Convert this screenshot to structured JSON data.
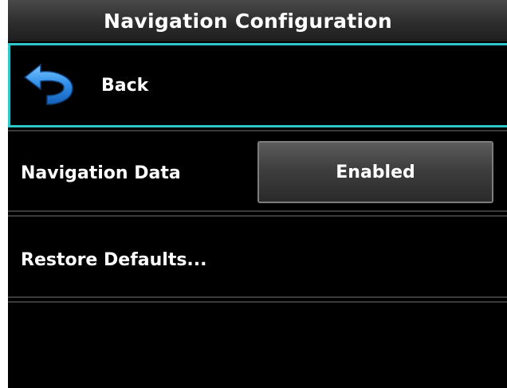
{
  "header": {
    "title": "Navigation Configuration"
  },
  "back_row": {
    "label": "Back",
    "icon": "back-arrow-icon"
  },
  "navigation_data_row": {
    "label": "Navigation Data",
    "value": "Enabled"
  },
  "restore_row": {
    "label": "Restore Defaults..."
  },
  "colors": {
    "background": "#000000",
    "selection_border": "#2ec7c9",
    "icon_blue": "#2f8ee8",
    "text": "#ffffff"
  }
}
